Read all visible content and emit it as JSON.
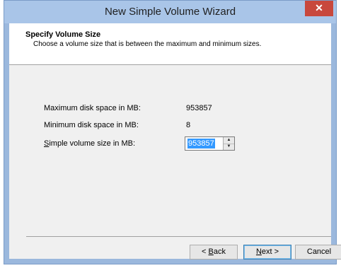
{
  "window": {
    "title": "New Simple Volume Wizard",
    "close_symbol": "✕"
  },
  "header": {
    "title": "Specify Volume Size",
    "subtitle": "Choose a volume size that is between the maximum and minimum sizes."
  },
  "fields": {
    "max_label": "Maximum disk space in MB:",
    "max_value": "953857",
    "min_label": "Minimum disk space in MB:",
    "min_value": "8",
    "size_label_mnemonic": "S",
    "size_label_rest": "imple volume size in MB:",
    "size_value": "953857"
  },
  "buttons": {
    "back_prefix": "< ",
    "back_mnemonic": "B",
    "back_rest": "ack",
    "next_mnemonic": "N",
    "next_rest": "ext >",
    "cancel": "Cancel"
  },
  "icons": {
    "spin_up": "▲",
    "spin_down": "▼"
  }
}
